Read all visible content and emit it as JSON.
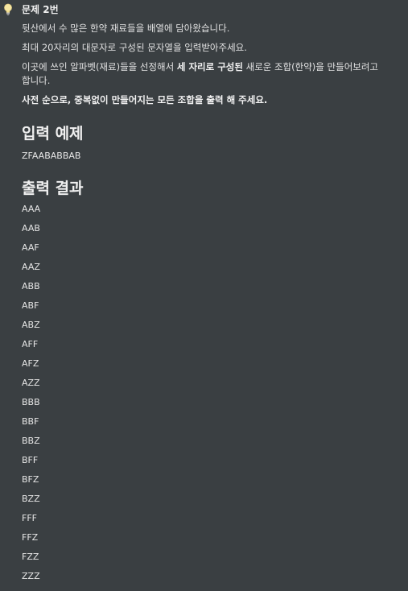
{
  "problem": {
    "icon": "lightbulb-icon",
    "title": "문제 2번",
    "line1": "뒷산에서 수 많은 한약 재료들을 배열에 담아왔습니다.",
    "line2": "최대 20자리의 대문자로 구성된 문자열을 입력받아주세요.",
    "line3_pre": "이곳에 쓰인 알파벳(재료)들을 선정해서 ",
    "line3_bold": "세 자리로 구성된",
    "line3_post": " 새로운 조합(한약)을 만들어보려고 합니다.",
    "line4_pre": "사전 순으로, 중복없이 만들어지는 모든 조합을 출력 ",
    "line4_mid": "해",
    "line4_post": " 주세요."
  },
  "input_section": {
    "heading": "입력 예제",
    "value": "ZFAABABBAB"
  },
  "output_section": {
    "heading": "출력 결과",
    "results": [
      "AAA",
      "AAB",
      "AAF",
      "AAZ",
      "ABB",
      "ABF",
      "ABZ",
      "AFF",
      "AFZ",
      "AZZ",
      "BBB",
      "BBF",
      "BBZ",
      "BFF",
      "BFZ",
      "BZZ",
      "FFF",
      "FFZ",
      "FZZ",
      "ZZZ"
    ]
  }
}
